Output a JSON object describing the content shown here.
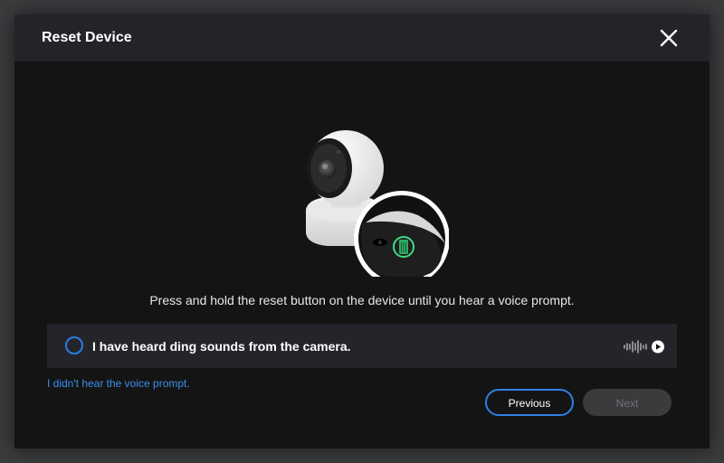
{
  "dialog": {
    "title": "Reset Device",
    "close_icon": "close-icon"
  },
  "illustration": {
    "description_icon": "camera-reset-button-illustration",
    "accent_color": "#3ddc84"
  },
  "instruction": "Press and hold the reset button on the device until you hear a voice prompt.",
  "confirm": {
    "label": "I have heard ding sounds from the camera.",
    "checked": false,
    "audio_icon": "sound-wave-play-icon"
  },
  "help_link": "I didn't hear the voice prompt.",
  "buttons": {
    "previous": "Previous",
    "next": "Next",
    "next_enabled": false
  },
  "colors": {
    "accent": "#2f7fe3",
    "link": "#3b8fea",
    "background": "#141415",
    "header": "#232428"
  }
}
